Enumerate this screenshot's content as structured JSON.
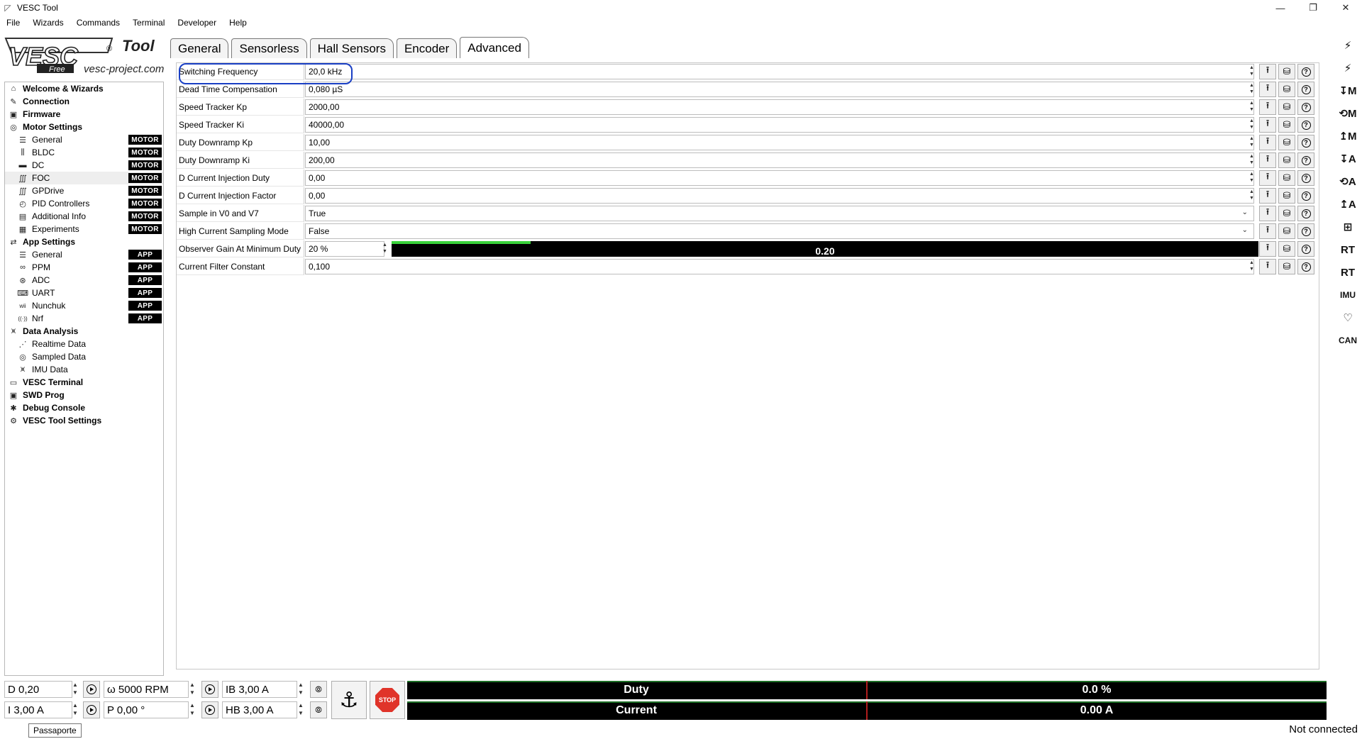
{
  "window": {
    "title": "VESC Tool"
  },
  "menu": [
    "File",
    "Wizards",
    "Commands",
    "Terminal",
    "Developer",
    "Help"
  ],
  "logo": {
    "main": "VESC",
    "sub": "Tool",
    "free": "Free",
    "site": "vesc-project.com"
  },
  "tabs": [
    "General",
    "Sensorless",
    "Hall Sensors",
    "Encoder",
    "Advanced"
  ],
  "sidebar": {
    "items": [
      {
        "label": "Welcome & Wizards",
        "level": "top",
        "icon": "home-icon",
        "glyph": "⌂"
      },
      {
        "label": "Connection",
        "level": "top",
        "icon": "plug-icon",
        "glyph": "✎"
      },
      {
        "label": "Firmware",
        "level": "top",
        "icon": "chip-icon",
        "glyph": "▣"
      },
      {
        "label": "Motor Settings",
        "level": "top",
        "icon": "motor-icon",
        "glyph": "◎"
      },
      {
        "label": "General",
        "level": "sub",
        "icon": "sliders-icon",
        "glyph": "☰",
        "badge": "MOTOR"
      },
      {
        "label": "BLDC",
        "level": "sub",
        "icon": "bldc-icon",
        "glyph": "⫼",
        "badge": "MOTOR"
      },
      {
        "label": "DC",
        "level": "sub",
        "icon": "battery-icon",
        "glyph": "▬",
        "badge": "MOTOR"
      },
      {
        "label": "FOC",
        "level": "sub",
        "icon": "foc-icon",
        "glyph": "∭",
        "badge": "MOTOR",
        "selected": true
      },
      {
        "label": "GPDrive",
        "level": "sub",
        "icon": "gpdrive-icon",
        "glyph": "∭",
        "badge": "MOTOR"
      },
      {
        "label": "PID Controllers",
        "level": "sub",
        "icon": "gauge-icon",
        "glyph": "◴",
        "badge": "MOTOR"
      },
      {
        "label": "Additional Info",
        "level": "sub",
        "icon": "info-icon",
        "glyph": "▤",
        "badge": "MOTOR"
      },
      {
        "label": "Experiments",
        "level": "sub",
        "icon": "calculator-icon",
        "glyph": "▦",
        "badge": "MOTOR"
      },
      {
        "label": "App Settings",
        "level": "top",
        "icon": "arrows-icon",
        "glyph": "⇄"
      },
      {
        "label": "General",
        "level": "sub",
        "icon": "sliders-icon",
        "glyph": "☰",
        "badge": "APP"
      },
      {
        "label": "PPM",
        "level": "sub",
        "icon": "gamepad-icon",
        "glyph": "∞",
        "badge": "APP"
      },
      {
        "label": "ADC",
        "level": "sub",
        "icon": "adc-icon",
        "glyph": "⊛",
        "badge": "APP"
      },
      {
        "label": "UART",
        "level": "sub",
        "icon": "keyboard-icon",
        "glyph": "⌨",
        "badge": "APP"
      },
      {
        "label": "Nunchuk",
        "level": "sub",
        "icon": "wii-icon",
        "glyph": "wii",
        "badge": "APP"
      },
      {
        "label": "Nrf",
        "level": "sub",
        "icon": "radio-icon",
        "glyph": "((·))",
        "badge": "APP"
      },
      {
        "label": "Data Analysis",
        "level": "top",
        "icon": "chart-icon",
        "glyph": "⩙"
      },
      {
        "label": "Realtime Data",
        "level": "sub",
        "icon": "realtime-icon",
        "glyph": "⋰"
      },
      {
        "label": "Sampled Data",
        "level": "sub",
        "icon": "sampled-icon",
        "glyph": "◎"
      },
      {
        "label": "IMU Data",
        "level": "sub",
        "icon": "imu-icon",
        "glyph": "⩙"
      },
      {
        "label": "VESC Terminal",
        "level": "top",
        "icon": "terminal-icon",
        "glyph": "▭"
      },
      {
        "label": "SWD Prog",
        "level": "top",
        "icon": "swd-icon",
        "glyph": "▣"
      },
      {
        "label": "Debug Console",
        "level": "top",
        "icon": "bug-icon",
        "glyph": "✱"
      },
      {
        "label": "VESC Tool Settings",
        "level": "top",
        "icon": "gear-icon",
        "glyph": "⚙"
      }
    ]
  },
  "params": [
    {
      "name": "Switching Frequency",
      "value": "20,0 kHz",
      "kind": "spin"
    },
    {
      "name": "Dead Time Compensation",
      "value": "0,080 µS",
      "kind": "spin"
    },
    {
      "name": "Speed Tracker Kp",
      "value": "2000,00",
      "kind": "spin"
    },
    {
      "name": "Speed Tracker Ki",
      "value": "40000,00",
      "kind": "spin"
    },
    {
      "name": "Duty Downramp Kp",
      "value": "10,00",
      "kind": "spin"
    },
    {
      "name": "Duty Downramp Ki",
      "value": "200,00",
      "kind": "spin"
    },
    {
      "name": "D Current Injection Duty",
      "value": "0,00",
      "kind": "spin"
    },
    {
      "name": "D Current Injection Factor",
      "value": "0,00",
      "kind": "spin"
    },
    {
      "name": "Sample in V0 and V7",
      "value": "True",
      "kind": "dropdown"
    },
    {
      "name": "High Current Sampling Mode",
      "value": "False",
      "kind": "dropdown"
    },
    {
      "name": "Observer Gain At Minimum Duty",
      "value": "20 %",
      "kind": "percent",
      "bar_text": "0.20",
      "bar_fraction": 0.16
    },
    {
      "name": "Current Filter Constant",
      "value": "0,100",
      "kind": "spin"
    }
  ],
  "right_toolbar": [
    {
      "icon": "connect-icon",
      "glyph": "⚡"
    },
    {
      "icon": "disconnect-icon",
      "glyph": "⚡"
    },
    {
      "icon": "read-motor-config-icon",
      "glyph": "↧M"
    },
    {
      "icon": "read-default-motor-icon",
      "glyph": "⟲M"
    },
    {
      "icon": "write-motor-config-icon",
      "glyph": "↥M"
    },
    {
      "icon": "read-app-config-icon",
      "glyph": "↧A"
    },
    {
      "icon": "read-default-app-icon",
      "glyph": "⟲A"
    },
    {
      "icon": "write-app-config-icon",
      "glyph": "↥A"
    },
    {
      "icon": "can-network-icon",
      "glyph": "⊞"
    },
    {
      "icon": "rt-data-icon",
      "glyph": "RT"
    },
    {
      "icon": "rt-app-icon",
      "glyph": "RT"
    },
    {
      "icon": "imu-icon",
      "glyph": "IMU"
    },
    {
      "icon": "heart-icon",
      "glyph": "♡"
    },
    {
      "icon": "can-fwd-icon",
      "glyph": "CAN"
    }
  ],
  "bottom": {
    "duty_input": "D 0,20",
    "rpm_input": "ω 5000 RPM",
    "brake_input": "IB 3,00 A",
    "current_input": "I 3,00 A",
    "position_input": "P 0,00 °",
    "handbrake_input": "HB 3,00 A",
    "anchor_glyph": "⚓",
    "stop_label": "STOP",
    "gauges": [
      {
        "label": "Duty",
        "value": "0.0 %"
      },
      {
        "label": "Current",
        "value": "0.00 A"
      }
    ],
    "tooltip": "Passaporte",
    "status": "Not connected"
  },
  "colors": {
    "accent_green": "#39d23a",
    "highlight_blue": "#1a3fc4",
    "stop_red": "#e0342a",
    "badge_black": "#000000"
  }
}
